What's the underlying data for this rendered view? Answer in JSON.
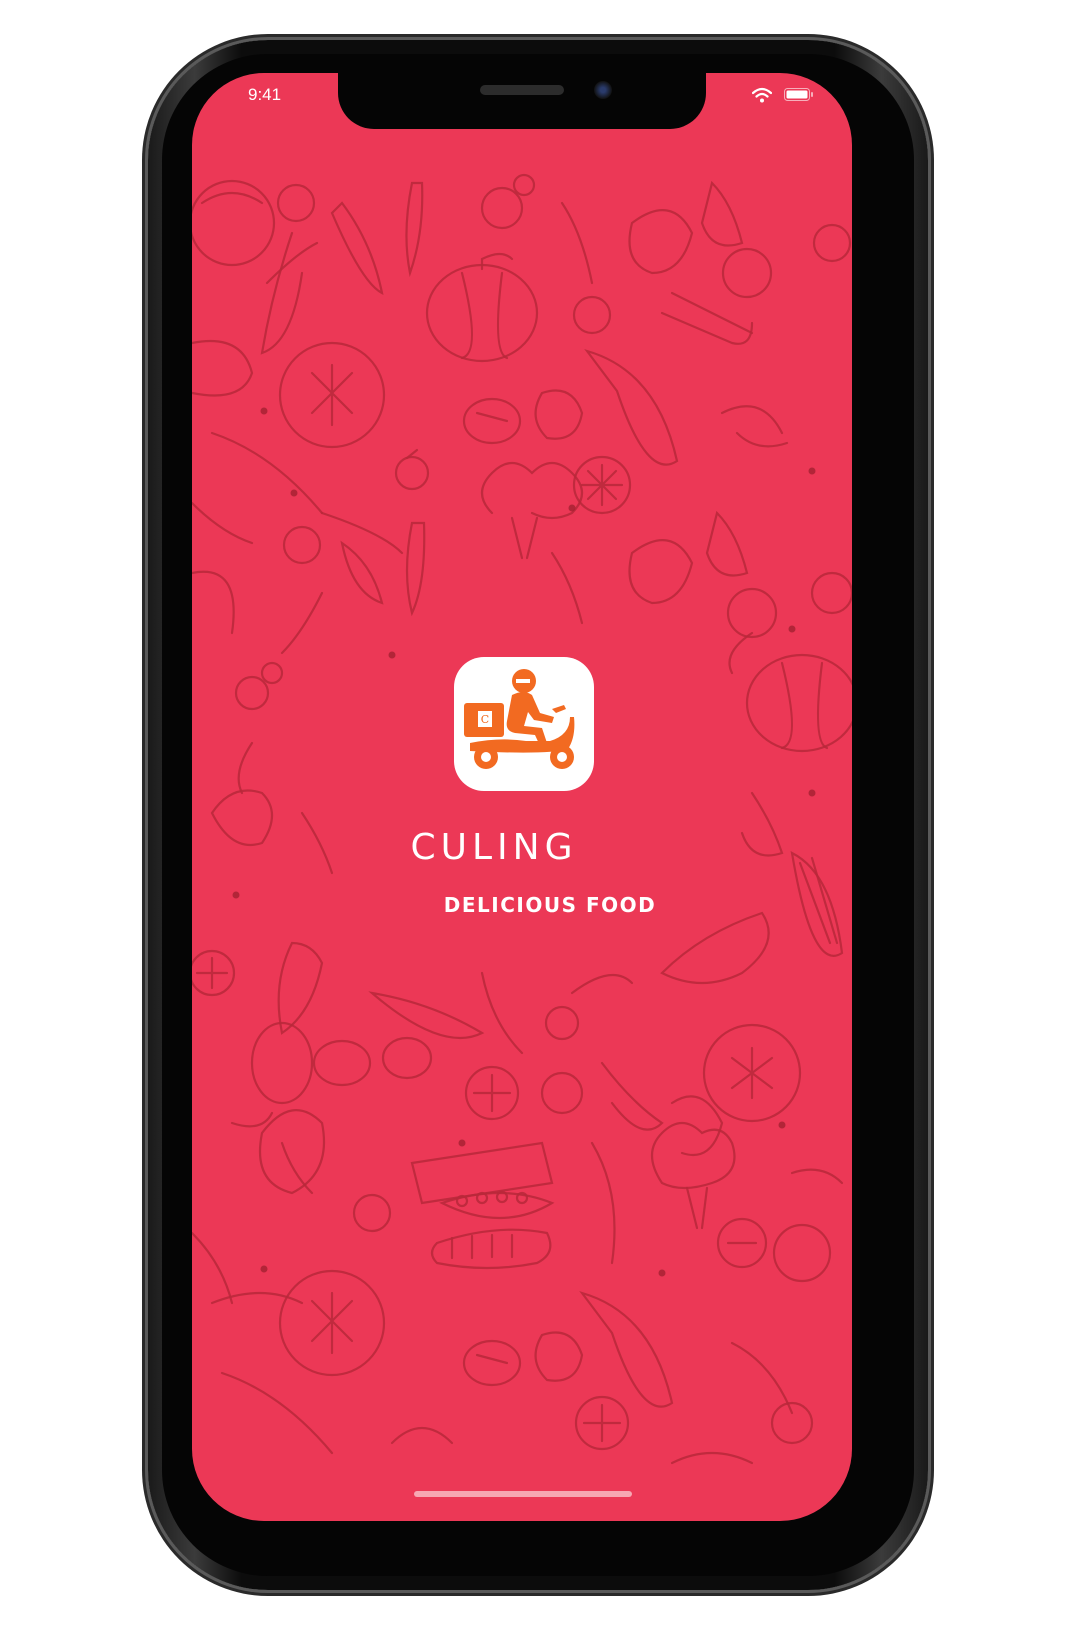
{
  "status_bar": {
    "time": "9:41",
    "wifi_icon": "wifi-icon",
    "battery_icon": "battery-icon"
  },
  "splash": {
    "app_icon": "delivery-scooter-icon",
    "app_icon_letter": "C",
    "brand_name": "CULING",
    "tagline": "DELICIOUS FOOD"
  },
  "colors": {
    "background": "#ec3856",
    "pattern": "#b8283a",
    "accent": "#f26a21",
    "text": "#ffffff"
  },
  "background_pattern": "food-doodle-pattern"
}
